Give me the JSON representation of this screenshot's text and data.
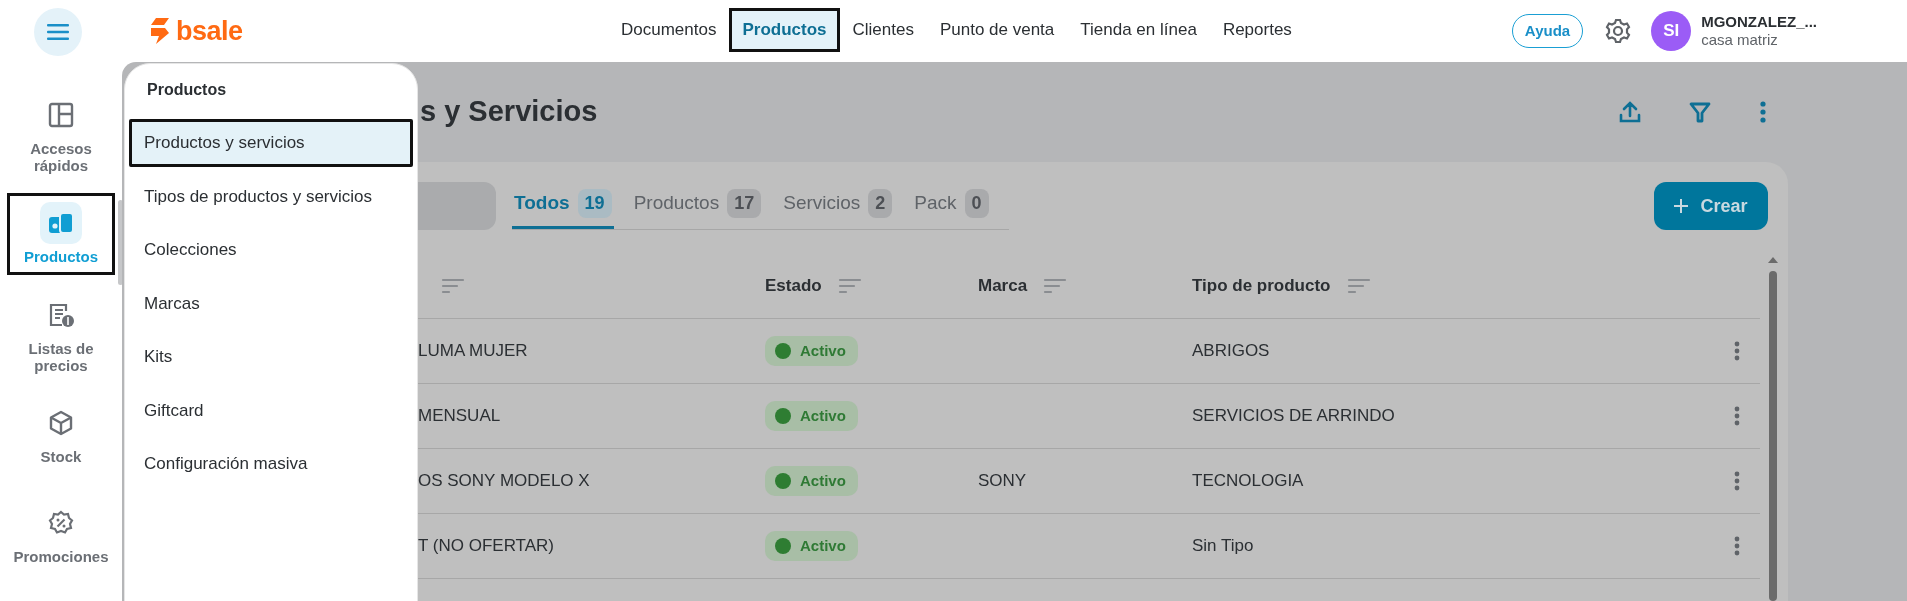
{
  "header": {
    "logo": "bsale",
    "nav": [
      {
        "label": "Documentos",
        "selected": false,
        "outlined": false
      },
      {
        "label": "Productos",
        "selected": true,
        "outlined": true
      },
      {
        "label": "Clientes",
        "selected": false,
        "outlined": false
      },
      {
        "label": "Punto de venta",
        "selected": false,
        "outlined": false
      },
      {
        "label": "Tienda en línea",
        "selected": false,
        "outlined": false
      },
      {
        "label": "Reportes",
        "selected": false,
        "outlined": false
      }
    ],
    "help_button": "Ayuda",
    "user": {
      "initials": "SI",
      "name": "MGONZALEZ_...",
      "branch": "casa matriz"
    }
  },
  "sidebar": {
    "items": [
      {
        "label": "Accesos rápidos",
        "kind": "layout",
        "selected": false,
        "outlined": false
      },
      {
        "label": "Productos",
        "kind": "products",
        "selected": true,
        "outlined": true
      },
      {
        "label": "Listas de precios",
        "kind": "pricelist",
        "selected": false,
        "outlined": false
      },
      {
        "label": "Stock",
        "kind": "cube",
        "selected": false,
        "outlined": false
      },
      {
        "label": "Promociones",
        "kind": "promo",
        "selected": false,
        "outlined": false
      }
    ]
  },
  "submenu": {
    "title": "Productos",
    "items": [
      {
        "label": "Productos y servicios",
        "selected": true,
        "outlined": true
      },
      {
        "label": "Tipos de productos y servicios",
        "selected": false,
        "outlined": false
      },
      {
        "label": "Colecciones",
        "selected": false,
        "outlined": false
      },
      {
        "label": "Marcas",
        "selected": false,
        "outlined": false
      },
      {
        "label": "Kits",
        "selected": false,
        "outlined": false
      },
      {
        "label": "Giftcard",
        "selected": false,
        "outlined": false
      },
      {
        "label": "Configuración masiva",
        "selected": false,
        "outlined": false
      }
    ]
  },
  "page": {
    "title": "s y Servicios"
  },
  "tabs": [
    {
      "label": "Todos",
      "count": "19",
      "selected": true
    },
    {
      "label": "Productos",
      "count": "17",
      "selected": false
    },
    {
      "label": "Servicios",
      "count": "2",
      "selected": false
    },
    {
      "label": "Pack",
      "count": "0",
      "selected": false
    }
  ],
  "create_button": "Crear",
  "table": {
    "columns": [
      "Estado",
      "Marca",
      "Tipo de producto"
    ],
    "rows": [
      {
        "column_1": "LUMA MUJER",
        "status": "Activo",
        "type": "ABRIGOS"
      },
      {
        "column_1": "MENSUAL",
        "status": "Activo",
        "type": "SERVICIOS DE ARRINDO"
      },
      {
        "column_1": "OS SONY MODELO X",
        "status": "Activo",
        "brand": "SONY",
        "type": "TECNOLOGIA"
      },
      {
        "column_1": "T (NO OFERTAR)",
        "status": "Activo",
        "type": "Sin Tipo"
      }
    ]
  }
}
